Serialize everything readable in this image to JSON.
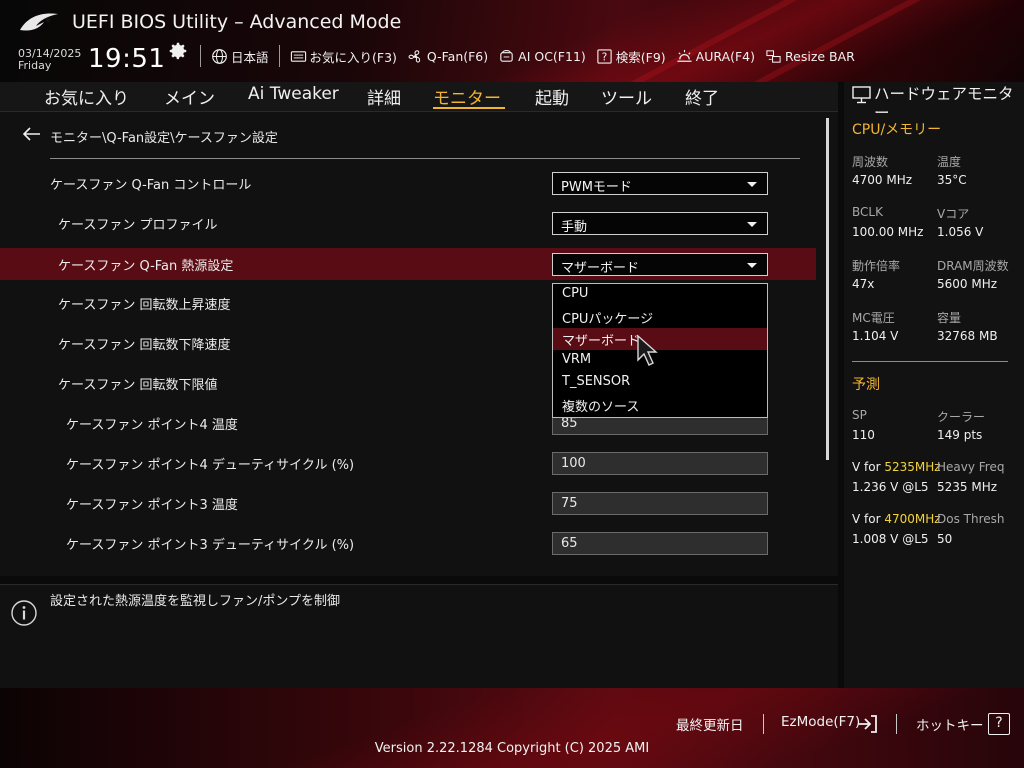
{
  "header": {
    "title": "UEFI BIOS Utility – Advanced Mode",
    "date": "03/14/2025",
    "day": "Friday",
    "time": "19:51",
    "tools": [
      {
        "label": "日本語",
        "icon": "globe-icon"
      },
      {
        "label": "お気に入り(F3)",
        "icon": "keyboard-icon"
      },
      {
        "label": "Q-Fan(F6)",
        "icon": "fan-icon"
      },
      {
        "label": "AI OC(F11)",
        "icon": "ai-chip-icon"
      },
      {
        "label": "検索(F9)",
        "icon": "search-help-icon"
      },
      {
        "label": "AURA(F4)",
        "icon": "aura-light-icon"
      },
      {
        "label": "Resize BAR",
        "icon": "resize-bar-icon"
      }
    ]
  },
  "nav": {
    "tabs": [
      "お気に入り",
      "メイン",
      "Ai Tweaker",
      "詳細",
      "モニター",
      "起動",
      "ツール",
      "終了"
    ],
    "active": "モニター"
  },
  "main": {
    "breadcrumb": "モニター\\Q-Fan設定\\ケースファン設定",
    "rows": [
      {
        "label": "ケースファン Q-Fan コントロール",
        "value": "PWMモード",
        "kind": "select"
      },
      {
        "label": "ケースファン プロファイル",
        "value": "手動",
        "kind": "select"
      },
      {
        "label": "ケースファン Q-Fan 熱源設定",
        "value": "マザーボード",
        "kind": "select"
      },
      {
        "label": "ケースファン 回転数上昇速度",
        "value": "",
        "kind": "none"
      },
      {
        "label": "ケースファン 回転数下降速度",
        "value": "",
        "kind": "none"
      },
      {
        "label": "ケースファン 回転数下限値",
        "value": "",
        "kind": "none"
      },
      {
        "label": "ケースファン ポイント4 温度",
        "value": "85",
        "kind": "field"
      },
      {
        "label": "ケースファン ポイント4 デューティサイクル (%)",
        "value": "100",
        "kind": "field"
      },
      {
        "label": "ケースファン ポイント3 温度",
        "value": "75",
        "kind": "field"
      },
      {
        "label": "ケースファン ポイント3 デューティサイクル (%)",
        "value": "65",
        "kind": "field"
      }
    ],
    "dropdown": {
      "options": [
        "CPU",
        "CPUパッケージ",
        "マザーボード",
        "VRM",
        "T_SENSOR",
        "複数のソース"
      ],
      "selected": "マザーボード"
    }
  },
  "help": {
    "text": "設定された熱源温度を監視しファン/ポンプを制御"
  },
  "hw_monitor": {
    "title": "ハードウェアモニター",
    "cpu_mem": {
      "section": "CPU/メモリー",
      "items": [
        {
          "key": "周波数",
          "value": "4700 MHz"
        },
        {
          "key": "温度",
          "value": "35°C"
        },
        {
          "key": "BCLK",
          "value": "100.00 MHz"
        },
        {
          "key": "Vコア",
          "value": "1.056 V"
        },
        {
          "key": "動作倍率",
          "value": "47x"
        },
        {
          "key": "DRAM周波数",
          "value": "5600 MHz"
        },
        {
          "key": "MC電圧",
          "value": "1.104 V"
        },
        {
          "key": "容量",
          "value": "32768 MB"
        }
      ]
    },
    "prediction": {
      "section": "予測",
      "sp_key": "SP",
      "sp_value": "110",
      "cooler_key": "クーラー",
      "cooler_value": "149 pts",
      "v1_prefix": "V for ",
      "v1_freq": "5235MHz",
      "v1_value": "1.236 V @L5",
      "heavy_key": "Heavy Freq",
      "heavy_value": "5235 MHz",
      "v2_prefix": "V for ",
      "v2_freq": "4700MHz",
      "v2_value": "1.008 V @L5",
      "dos_key": "Dos Thresh",
      "dos_value": "50"
    }
  },
  "footer": {
    "last_modified": "最終更新日",
    "ezmode": "EzMode(F7)",
    "hotkeys": "ホットキー",
    "hotkey_glyph": "?",
    "version": "Version 2.22.1284 Copyright (C) 2025 AMI"
  },
  "colors": {
    "accent": "#f2b531",
    "highlight": "#5a0c14",
    "brand_red": "#c0141e"
  }
}
